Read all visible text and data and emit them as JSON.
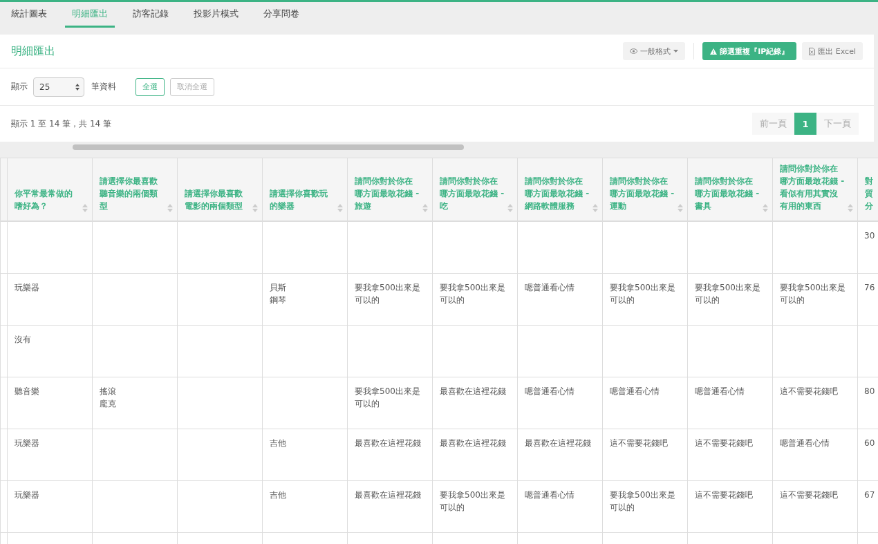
{
  "tabs": [
    {
      "label": "統計圖表",
      "selected": false
    },
    {
      "label": "明細匯出",
      "selected": true
    },
    {
      "label": "訪客記錄",
      "selected": false
    },
    {
      "label": "投影片模式",
      "selected": false
    },
    {
      "label": "分享問卷",
      "selected": false
    }
  ],
  "panel": {
    "title": "明細匯出",
    "format_button": "一般格式",
    "filter_button": "篩選重複『IP紀錄』",
    "export_button": "匯出 Excel"
  },
  "controls": {
    "show_label": "顯示",
    "page_size": "25",
    "records_label": "筆資料",
    "select_all": {
      "label": "全選",
      "disabled": false
    },
    "deselect_all": {
      "label": "取消全選",
      "disabled": true
    }
  },
  "info": "顯示 1 至 14 筆，共 14 筆",
  "pagination": [
    {
      "label": "前一頁",
      "kind": "nav",
      "disabled": true,
      "selected": false
    },
    {
      "label": "1",
      "kind": "page",
      "disabled": false,
      "selected": true
    },
    {
      "label": "下一頁",
      "kind": "nav",
      "disabled": true,
      "selected": false
    }
  ],
  "table": {
    "columns": [
      "你平常最常做的嗜好為？",
      "請選擇你最喜歡聽音樂的兩個類型",
      "請選擇你最喜歡電影的兩個類型",
      "請選擇你喜歡玩的樂器",
      "請問你對於你在哪方面最敢花錢 - 旅遊",
      "請問你對於你在哪方面最敢花錢 - 吃",
      "請問你對於你在哪方面最敢花錢 - 網路軟體服務",
      "請問你對於你在哪方面最敢花錢 - 運動",
      "請問你對於你在哪方面最敢花錢 - 書具",
      "請問你對於你在哪方面最敢花錢 - 看似有用其實沒有用的東西",
      "對質分"
    ],
    "rows": [
      [
        null,
        null,
        null,
        null,
        null,
        null,
        null,
        null,
        null,
        null,
        [
          "30"
        ]
      ],
      [
        [
          "玩樂器"
        ],
        null,
        null,
        [
          "貝斯",
          "鋼琴"
        ],
        [
          "要我拿500出來是可以的"
        ],
        [
          "要我拿500出來是可以的"
        ],
        [
          "嗯普通看心情"
        ],
        [
          "要我拿500出來是可以的"
        ],
        [
          "要我拿500出來是可以的"
        ],
        [
          "要我拿500出來是可以的"
        ],
        [
          "76"
        ]
      ],
      [
        [
          "沒有"
        ],
        null,
        null,
        null,
        null,
        null,
        null,
        null,
        null,
        null,
        null
      ],
      [
        [
          "聽音樂"
        ],
        [
          "搖滾",
          "龐克"
        ],
        null,
        null,
        [
          "要我拿500出來是可以的"
        ],
        [
          "最喜歡在這裡花錢"
        ],
        [
          "嗯普通看心情"
        ],
        [
          "嗯普通看心情"
        ],
        [
          "嗯普通看心情"
        ],
        [
          "這不需要花錢吧"
        ],
        [
          "80"
        ]
      ],
      [
        [
          "玩樂器"
        ],
        null,
        null,
        [
          "吉他"
        ],
        [
          "最喜歡在這裡花錢"
        ],
        [
          "最喜歡在這裡花錢"
        ],
        [
          "最喜歡在這裡花錢"
        ],
        [
          "這不需要花錢吧"
        ],
        [
          "這不需要花錢吧"
        ],
        [
          "嗯普通看心情"
        ],
        [
          "60"
        ]
      ],
      [
        [
          "玩樂器"
        ],
        null,
        null,
        [
          "吉他"
        ],
        [
          "最喜歡在這裡花錢"
        ],
        [
          "要我拿500出來是可以的"
        ],
        [
          "嗯普通看心情"
        ],
        [
          "要我拿500出來是可以的"
        ],
        [
          "這不需要花錢吧"
        ],
        [
          "這不需要花錢吧"
        ],
        [
          "67"
        ]
      ]
    ]
  }
}
